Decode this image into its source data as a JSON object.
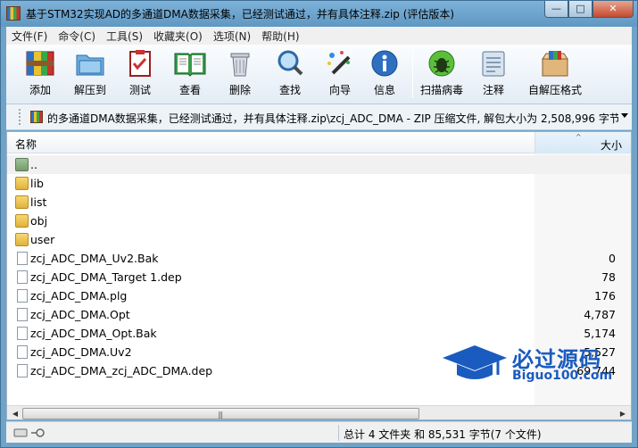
{
  "window": {
    "title": "基于STM32实现AD的多通道DMA数据采集，已经测试通过，并有具体注释.zip (评估版本)",
    "minimize": "—",
    "maximize": "□",
    "close": "✕"
  },
  "menu": [
    "文件(F)",
    "命令(C)",
    "工具(S)",
    "收藏夹(O)",
    "选项(N)",
    "帮助(H)"
  ],
  "toolbar": {
    "add": "添加",
    "extract": "解压到",
    "test": "测试",
    "view": "查看",
    "delete": "删除",
    "find": "查找",
    "wizard": "向导",
    "info": "信息",
    "virus": "扫描病毒",
    "comment": "注释",
    "sfx": "自解压格式"
  },
  "address": {
    "path": "的多通道DMA数据采集，已经测试通过，并有具体注释.zip\\zcj_ADC_DMA - ZIP 压缩文件, 解包大小为 2,508,996 字节"
  },
  "columns": {
    "name": "名称",
    "size": "大小"
  },
  "files": [
    {
      "name": "..",
      "type": "up",
      "size": ""
    },
    {
      "name": "lib",
      "type": "folder",
      "size": ""
    },
    {
      "name": "list",
      "type": "folder",
      "size": ""
    },
    {
      "name": "obj",
      "type": "folder",
      "size": ""
    },
    {
      "name": "user",
      "type": "folder",
      "size": ""
    },
    {
      "name": "zcj_ADC_DMA_Uv2.Bak",
      "type": "file",
      "size": "0"
    },
    {
      "name": "zcj_ADC_DMA_Target 1.dep",
      "type": "file",
      "size": "78"
    },
    {
      "name": "zcj_ADC_DMA.plg",
      "type": "file",
      "size": "176"
    },
    {
      "name": "zcj_ADC_DMA.Opt",
      "type": "file",
      "size": "4,787"
    },
    {
      "name": "zcj_ADC_DMA_Opt.Bak",
      "type": "file",
      "size": "5,174"
    },
    {
      "name": "zcj_ADC_DMA.Uv2",
      "type": "file",
      "size": "5,527"
    },
    {
      "name": "zcj_ADC_DMA_zcj_ADC_DMA.dep",
      "type": "file",
      "size": "69,744"
    }
  ],
  "status": {
    "summary": "总计 4 文件夹 和 85,531 字节(7 个文件)"
  },
  "watermark": {
    "cn": "必过源码",
    "en": "Biguo100.com"
  },
  "colors": {
    "titlebar": "#6fa3c8",
    "watermark": "#1a5bbf",
    "folder": "#f2c94c"
  }
}
